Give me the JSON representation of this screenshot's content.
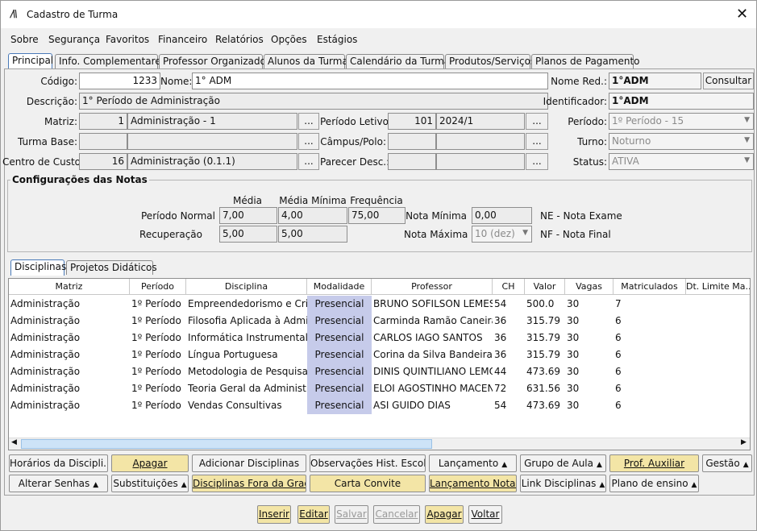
{
  "window": {
    "title": "Cadastro de Turma",
    "close_label": "✕",
    "logo": "/\\\\"
  },
  "menu": [
    "Sobre",
    "Segurança",
    "Favoritos",
    "Financeiro",
    "Relatórios",
    "Opções",
    "Estágios"
  ],
  "tabs": [
    "Principal",
    "Info. Complementares",
    "Professor Organizador",
    "Alunos da Turma",
    "Calendário da Turma",
    "Produtos/Serviços",
    "Planos de Pagamento"
  ],
  "form": {
    "codigo_label": "Código:",
    "codigo_value": "1233",
    "nome_label": "Nome:",
    "nome_value": "1° ADM",
    "nome_red_label": "Nome Red.:",
    "nome_red_value": "1°ADM",
    "consultar_label": "Consultar",
    "descricao_label": "Descrição:",
    "descricao_value": "1° Período de Administração",
    "identificador_label": "Identificador:",
    "identificador_value": "1°ADM",
    "matriz_label": "Matriz:",
    "matriz_code": "1",
    "matriz_name": "Administração - 1",
    "periodo_letivo_label": "Período Letivo:",
    "periodo_letivo_code": "101",
    "periodo_letivo_name": "2024/1",
    "periodo_label": "Período:",
    "periodo_value": "1º Período - 15",
    "turma_base_label": "Turma Base:",
    "campus_label": "Câmpus/Polo:",
    "turno_label": "Turno:",
    "turno_value": "Noturno",
    "centro_custo_label": "Centro de Custo:",
    "centro_custo_code": "16",
    "centro_custo_name": "Administração (0.1.1)",
    "parecer_label": "Parecer Desc.:",
    "status_label": "Status:",
    "status_value": "ATIVA",
    "ellipsis": "..."
  },
  "notas": {
    "title": "Configurações das Notas",
    "col_media": "Média",
    "col_media_minima": "Média Mínima",
    "col_frequencia": "Frequência",
    "periodo_normal_label": "Período Normal",
    "pn_media": "7,00",
    "pn_media_minima": "4,00",
    "pn_frequencia": "75,00",
    "recuperacao_label": "Recuperação",
    "rec_media": "5,00",
    "rec_media_minima": "5,00",
    "nota_minima_label": "Nota Mínima",
    "nota_minima_value": "0,00",
    "nota_maxima_label": "Nota Máxima",
    "nota_maxima_value": "10 (dez)",
    "ne_label": "NE - Nota Exame",
    "nf_label": "NF - Nota Final"
  },
  "subtabs": [
    "Disciplinas",
    "Projetos Didáticos"
  ],
  "table": {
    "columns": [
      "Matriz",
      "Período",
      "Disciplina",
      "Modalidade",
      "Professor",
      "CH",
      "Valor",
      "Vagas",
      "Matriculados",
      "Dt. Limite Ma..."
    ],
    "rows": [
      [
        "Administração",
        "1º Período",
        "Empreendedorismo e Criação",
        "Presencial",
        "BRUNO SOFILSON LEMES",
        "54",
        "500.0",
        "30",
        "7",
        ""
      ],
      [
        "Administração",
        "1º Período",
        "Filosofia Aplicada à Administração",
        "Presencial",
        "Carminda Ramão Caneira",
        "36",
        "315.79",
        "30",
        "6",
        ""
      ],
      [
        "Administração",
        "1º Período",
        "Informática Instrumental",
        "Presencial",
        "CARLOS IAGO SANTOS",
        "36",
        "315.79",
        "30",
        "6",
        ""
      ],
      [
        "Administração",
        "1º Período",
        "Língua Portuguesa",
        "Presencial",
        "Corina da Silva Bandeira",
        "36",
        "315.79",
        "30",
        "6",
        ""
      ],
      [
        "Administração",
        "1º Período",
        "Metodologia de Pesquisa",
        "Presencial",
        "DINIS QUINTILIANO LEMOS",
        "44",
        "473.69",
        "30",
        "6",
        ""
      ],
      [
        "Administração",
        "1º Período",
        "Teoria Geral da Administração",
        "Presencial",
        "ELOI AGOSTINHO MACENA",
        "72",
        "631.56",
        "30",
        "6",
        ""
      ],
      [
        "Administração",
        "1º Período",
        "Vendas Consultivas",
        "Presencial",
        "ASI GUIDO DIAS",
        "54",
        "473.69",
        "30",
        "6",
        ""
      ]
    ]
  },
  "actions_row1": [
    "Horários da Discipli...",
    "Apagar",
    "Adicionar Disciplinas",
    "Observações Hist. Escolar",
    "Lançamento",
    "Grupo de Aula",
    "Prof. Auxiliar",
    "Gestão"
  ],
  "actions_row2": [
    "Alterar Senhas",
    "Substituições",
    "Disciplinas Fora da Grade",
    "Carta Convite",
    "Lançamento Notas",
    "Link Disciplinas",
    "Plano de ensino"
  ],
  "footer": [
    "Inserir",
    "Editar",
    "Salvar",
    "Cancelar",
    "Apagar",
    "Voltar"
  ],
  "colors": {
    "accent_yellow": "#f3e5a6",
    "modalidade_bg": "#c6cbea",
    "active_tab_border": "#4a7ab8"
  },
  "icons": {
    "caret": "caret-up-icon",
    "dropdown": "chevron-down-icon",
    "close": "close-icon"
  }
}
